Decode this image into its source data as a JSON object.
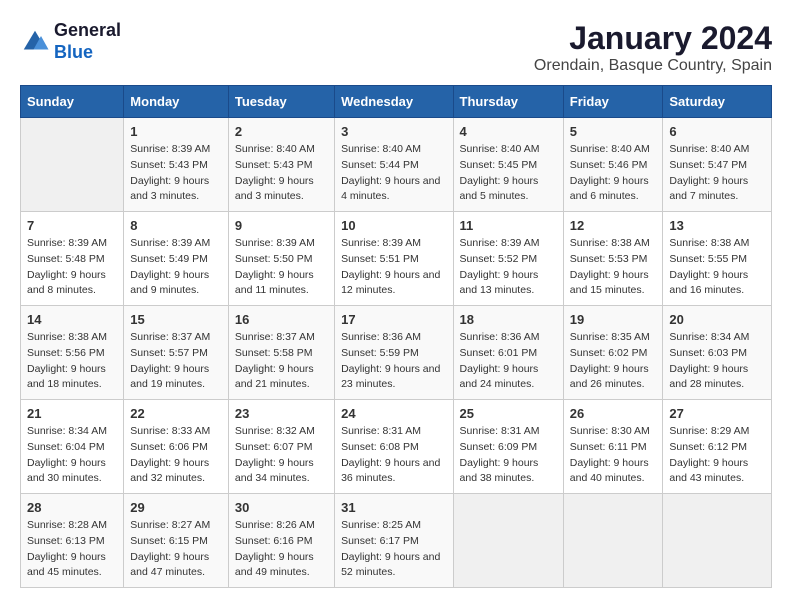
{
  "logo": {
    "line1": "General",
    "line2": "Blue"
  },
  "title": "January 2024",
  "subtitle": "Orendain, Basque Country, Spain",
  "days_of_week": [
    "Sunday",
    "Monday",
    "Tuesday",
    "Wednesday",
    "Thursday",
    "Friday",
    "Saturday"
  ],
  "weeks": [
    [
      {
        "date": "",
        "sunrise": "",
        "sunset": "",
        "daylight": ""
      },
      {
        "date": "1",
        "sunrise": "Sunrise: 8:39 AM",
        "sunset": "Sunset: 5:43 PM",
        "daylight": "Daylight: 9 hours and 3 minutes."
      },
      {
        "date": "2",
        "sunrise": "Sunrise: 8:40 AM",
        "sunset": "Sunset: 5:43 PM",
        "daylight": "Daylight: 9 hours and 3 minutes."
      },
      {
        "date": "3",
        "sunrise": "Sunrise: 8:40 AM",
        "sunset": "Sunset: 5:44 PM",
        "daylight": "Daylight: 9 hours and 4 minutes."
      },
      {
        "date": "4",
        "sunrise": "Sunrise: 8:40 AM",
        "sunset": "Sunset: 5:45 PM",
        "daylight": "Daylight: 9 hours and 5 minutes."
      },
      {
        "date": "5",
        "sunrise": "Sunrise: 8:40 AM",
        "sunset": "Sunset: 5:46 PM",
        "daylight": "Daylight: 9 hours and 6 minutes."
      },
      {
        "date": "6",
        "sunrise": "Sunrise: 8:40 AM",
        "sunset": "Sunset: 5:47 PM",
        "daylight": "Daylight: 9 hours and 7 minutes."
      }
    ],
    [
      {
        "date": "7",
        "sunrise": "Sunrise: 8:39 AM",
        "sunset": "Sunset: 5:48 PM",
        "daylight": "Daylight: 9 hours and 8 minutes."
      },
      {
        "date": "8",
        "sunrise": "Sunrise: 8:39 AM",
        "sunset": "Sunset: 5:49 PM",
        "daylight": "Daylight: 9 hours and 9 minutes."
      },
      {
        "date": "9",
        "sunrise": "Sunrise: 8:39 AM",
        "sunset": "Sunset: 5:50 PM",
        "daylight": "Daylight: 9 hours and 11 minutes."
      },
      {
        "date": "10",
        "sunrise": "Sunrise: 8:39 AM",
        "sunset": "Sunset: 5:51 PM",
        "daylight": "Daylight: 9 hours and 12 minutes."
      },
      {
        "date": "11",
        "sunrise": "Sunrise: 8:39 AM",
        "sunset": "Sunset: 5:52 PM",
        "daylight": "Daylight: 9 hours and 13 minutes."
      },
      {
        "date": "12",
        "sunrise": "Sunrise: 8:38 AM",
        "sunset": "Sunset: 5:53 PM",
        "daylight": "Daylight: 9 hours and 15 minutes."
      },
      {
        "date": "13",
        "sunrise": "Sunrise: 8:38 AM",
        "sunset": "Sunset: 5:55 PM",
        "daylight": "Daylight: 9 hours and 16 minutes."
      }
    ],
    [
      {
        "date": "14",
        "sunrise": "Sunrise: 8:38 AM",
        "sunset": "Sunset: 5:56 PM",
        "daylight": "Daylight: 9 hours and 18 minutes."
      },
      {
        "date": "15",
        "sunrise": "Sunrise: 8:37 AM",
        "sunset": "Sunset: 5:57 PM",
        "daylight": "Daylight: 9 hours and 19 minutes."
      },
      {
        "date": "16",
        "sunrise": "Sunrise: 8:37 AM",
        "sunset": "Sunset: 5:58 PM",
        "daylight": "Daylight: 9 hours and 21 minutes."
      },
      {
        "date": "17",
        "sunrise": "Sunrise: 8:36 AM",
        "sunset": "Sunset: 5:59 PM",
        "daylight": "Daylight: 9 hours and 23 minutes."
      },
      {
        "date": "18",
        "sunrise": "Sunrise: 8:36 AM",
        "sunset": "Sunset: 6:01 PM",
        "daylight": "Daylight: 9 hours and 24 minutes."
      },
      {
        "date": "19",
        "sunrise": "Sunrise: 8:35 AM",
        "sunset": "Sunset: 6:02 PM",
        "daylight": "Daylight: 9 hours and 26 minutes."
      },
      {
        "date": "20",
        "sunrise": "Sunrise: 8:34 AM",
        "sunset": "Sunset: 6:03 PM",
        "daylight": "Daylight: 9 hours and 28 minutes."
      }
    ],
    [
      {
        "date": "21",
        "sunrise": "Sunrise: 8:34 AM",
        "sunset": "Sunset: 6:04 PM",
        "daylight": "Daylight: 9 hours and 30 minutes."
      },
      {
        "date": "22",
        "sunrise": "Sunrise: 8:33 AM",
        "sunset": "Sunset: 6:06 PM",
        "daylight": "Daylight: 9 hours and 32 minutes."
      },
      {
        "date": "23",
        "sunrise": "Sunrise: 8:32 AM",
        "sunset": "Sunset: 6:07 PM",
        "daylight": "Daylight: 9 hours and 34 minutes."
      },
      {
        "date": "24",
        "sunrise": "Sunrise: 8:31 AM",
        "sunset": "Sunset: 6:08 PM",
        "daylight": "Daylight: 9 hours and 36 minutes."
      },
      {
        "date": "25",
        "sunrise": "Sunrise: 8:31 AM",
        "sunset": "Sunset: 6:09 PM",
        "daylight": "Daylight: 9 hours and 38 minutes."
      },
      {
        "date": "26",
        "sunrise": "Sunrise: 8:30 AM",
        "sunset": "Sunset: 6:11 PM",
        "daylight": "Daylight: 9 hours and 40 minutes."
      },
      {
        "date": "27",
        "sunrise": "Sunrise: 8:29 AM",
        "sunset": "Sunset: 6:12 PM",
        "daylight": "Daylight: 9 hours and 43 minutes."
      }
    ],
    [
      {
        "date": "28",
        "sunrise": "Sunrise: 8:28 AM",
        "sunset": "Sunset: 6:13 PM",
        "daylight": "Daylight: 9 hours and 45 minutes."
      },
      {
        "date": "29",
        "sunrise": "Sunrise: 8:27 AM",
        "sunset": "Sunset: 6:15 PM",
        "daylight": "Daylight: 9 hours and 47 minutes."
      },
      {
        "date": "30",
        "sunrise": "Sunrise: 8:26 AM",
        "sunset": "Sunset: 6:16 PM",
        "daylight": "Daylight: 9 hours and 49 minutes."
      },
      {
        "date": "31",
        "sunrise": "Sunrise: 8:25 AM",
        "sunset": "Sunset: 6:17 PM",
        "daylight": "Daylight: 9 hours and 52 minutes."
      },
      {
        "date": "",
        "sunrise": "",
        "sunset": "",
        "daylight": ""
      },
      {
        "date": "",
        "sunrise": "",
        "sunset": "",
        "daylight": ""
      },
      {
        "date": "",
        "sunrise": "",
        "sunset": "",
        "daylight": ""
      }
    ]
  ]
}
